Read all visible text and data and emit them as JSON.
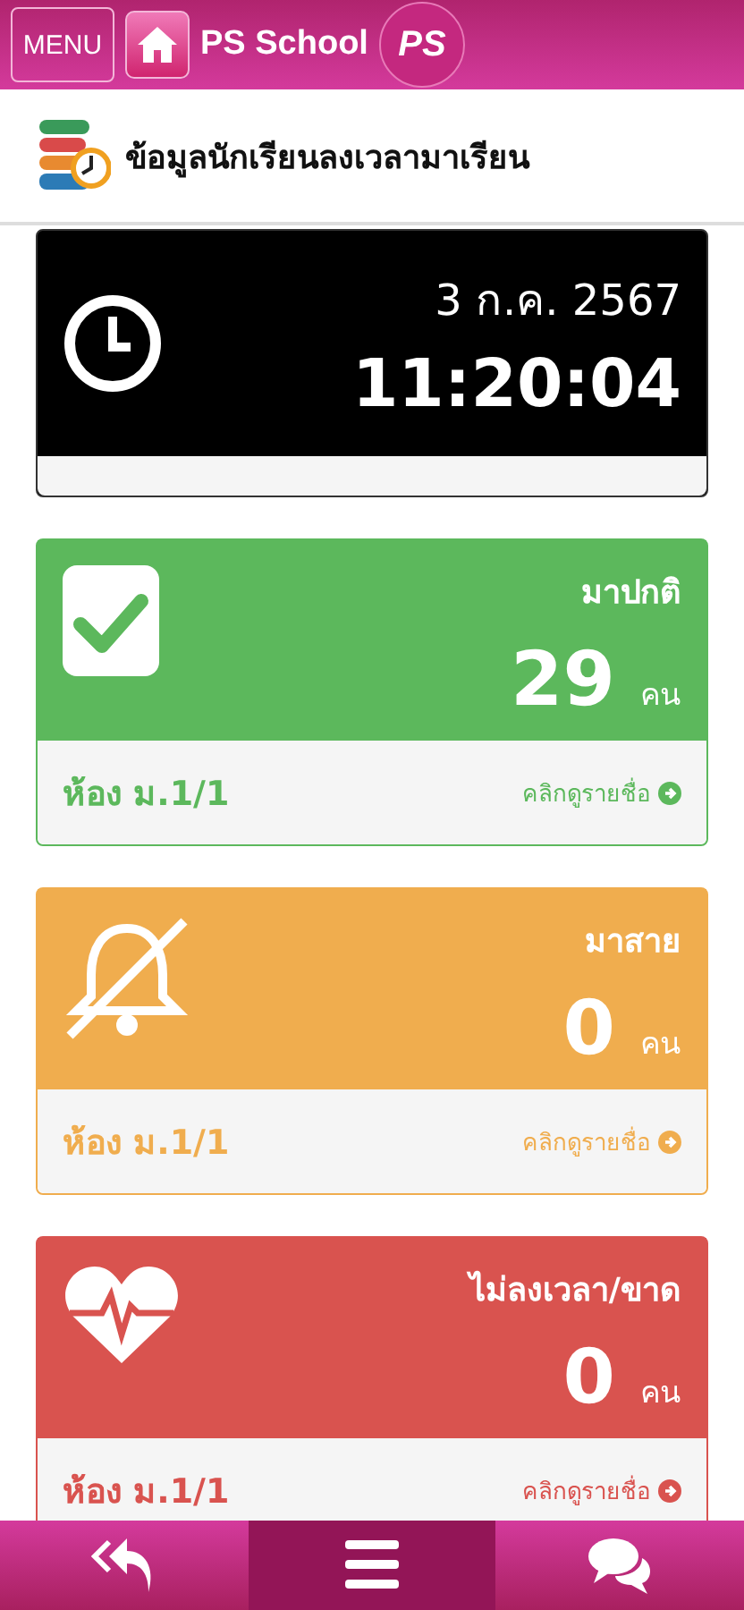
{
  "header": {
    "menu_label": "MENU",
    "app_name": "PS School",
    "logo_text": "PS"
  },
  "page_title": "ข้อมูลนักเรียนลงเวลามาเรียน",
  "clock": {
    "date": "3 ก.ค. 2567",
    "time": "11:20:04"
  },
  "cards": [
    {
      "kind": "present",
      "color": "#5cb85c",
      "label": "มาปกติ",
      "count": "29",
      "unit": "คน",
      "room": "ห้อง ม.1/1",
      "link": "คลิกดูรายชื่อ"
    },
    {
      "kind": "late",
      "color": "#f0ad4e",
      "label": "มาสาย",
      "count": "0",
      "unit": "คน",
      "room": "ห้อง ม.1/1",
      "link": "คลิกดูรายชื่อ"
    },
    {
      "kind": "absent",
      "color": "#d9534f",
      "label": "ไม่ลงเวลา/ขาด",
      "count": "0",
      "unit": "คน",
      "room": "ห้อง ม.1/1",
      "link": "คลิกดูรายชื่อ"
    }
  ],
  "bottom_nav": [
    {
      "kind": "back",
      "selected": false
    },
    {
      "kind": "menu",
      "selected": true
    },
    {
      "kind": "chat",
      "selected": false
    }
  ]
}
